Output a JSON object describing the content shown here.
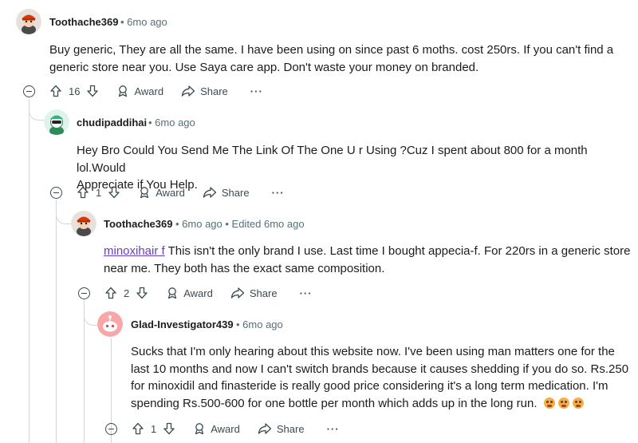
{
  "comments": [
    {
      "username": "Toothache369",
      "meta": "• 6mo ago",
      "body_lines": [
        "Buy generic, They are all the same. I have been using on since past 6 moths. cost 250rs. If you can't find a",
        "generic store near you. Use Saya care app. Don't waste your money on branded."
      ],
      "votes": "16",
      "award": "Award",
      "share": "Share",
      "more": "···"
    },
    {
      "username": "chudipaddihai",
      "meta": "• 6mo ago",
      "body_lines": [
        "Hey Bro Could You Send Me The Link Of The One U r Using ?Cuz I spent about 800 for a month lol.Would",
        "Appreciate if You Help."
      ],
      "votes": "1",
      "award": "Award",
      "share": "Share",
      "more": "···"
    },
    {
      "username": "Toothache369",
      "meta": "• 6mo ago • Edited 6mo ago",
      "link": "minoxihair f",
      "body_lines": [
        " This isn't the only brand I use. Last time I bought appecia-f. For 220rs in a generic store",
        "near me. They both has the exact same composition."
      ],
      "votes": "2",
      "award": "Award",
      "share": "Share",
      "more": "···"
    },
    {
      "username": "Glad-Investigator439",
      "meta": "• 6mo ago",
      "body_lines": [
        "Sucks that I'm only hearing about this website now. I've been using man matters one for the",
        "last 10 months and now I can't switch brands because it causes shedding if you do so. Rs.250",
        "for minoxidil and finasteride is really good price considering it's a long term medication. I'm",
        "spending Rs.500-600 for one bottle per month which adds up in the long run."
      ],
      "votes": "1",
      "award": "Award",
      "share": "Share",
      "more": "···"
    }
  ],
  "colors": {
    "text": "#1c1c1c",
    "meta": "#576f76",
    "link": "#6a3dbd",
    "thread": "#d4d7d9"
  },
  "icons": [
    "upvote-icon",
    "downvote-icon",
    "award-icon",
    "share-icon",
    "collapse-icon",
    "avatar-icon",
    "emoji-icon"
  ]
}
